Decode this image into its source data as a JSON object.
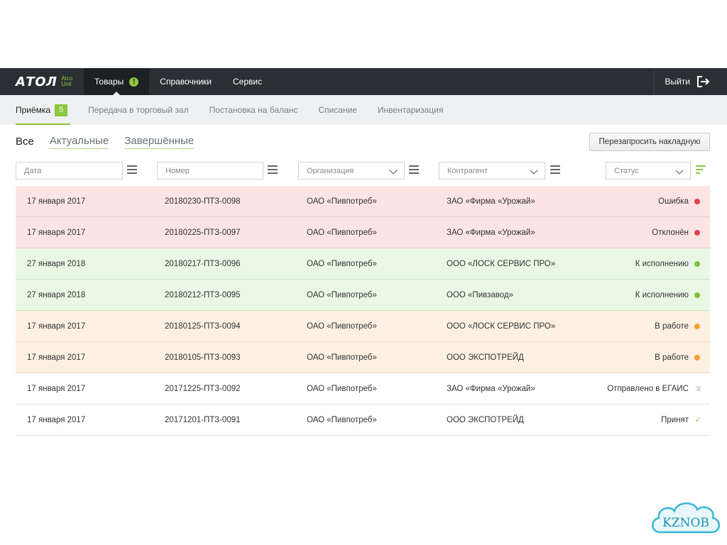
{
  "brand": {
    "name": "АТОЛ",
    "sub1": "Alco",
    "sub2": "Unit"
  },
  "nav": {
    "items": [
      {
        "label": "Товары",
        "alert": "!"
      },
      {
        "label": "Справочники"
      },
      {
        "label": "Сервис"
      }
    ],
    "logout_label": "Выйти"
  },
  "subnav": {
    "items": [
      {
        "label": "Приёмка",
        "badge": "5"
      },
      {
        "label": "Передача в торговый зал"
      },
      {
        "label": "Постановка на баланс"
      },
      {
        "label": "Списание"
      },
      {
        "label": "Инвентаризация"
      }
    ]
  },
  "tabs": [
    "Все",
    "Актуальные",
    "Завершённые"
  ],
  "reload_button": "Перезапросить накладную",
  "filters": {
    "date_placeholder": "Дата",
    "number_placeholder": "Номер",
    "org_placeholder": "Организация",
    "contractor_placeholder": "Контрагент",
    "status_placeholder": "Статус"
  },
  "rows": [
    {
      "date": "17 января 2017",
      "number": "20180230-ПТЗ-0098",
      "org": "ОАО «Пивпотреб»",
      "contractor": "ЗАО «Фирма «Урожай»",
      "status": "Ошибка",
      "tone": "red",
      "icon": "red-dot-icon"
    },
    {
      "date": "17 января 2017",
      "number": "20180225-ПТЗ-0097",
      "org": "ОАО «Пивпотреб»",
      "contractor": "ЗАО «Фирма «Урожай»",
      "status": "Отклонён",
      "tone": "red",
      "icon": "red-dot-icon"
    },
    {
      "date": "27 января 2018",
      "number": "20180217-ПТЗ-0096",
      "org": "ОАО «Пивпотреб»",
      "contractor": "ООО «ЛОСК СЕРВИС ПРО»",
      "status": "К исполнению",
      "tone": "green",
      "icon": "green-dot-icon"
    },
    {
      "date": "27 января 2018",
      "number": "20180212-ПТЗ-0095",
      "org": "ОАО «Пивпотреб»",
      "contractor": "ООО «Пивзавод»",
      "status": "К исполнению",
      "tone": "green",
      "icon": "green-dot-icon"
    },
    {
      "date": "17 января 2017",
      "number": "20180125-ПТЗ-0094",
      "org": "ОАО «Пивпотреб»",
      "contractor": "ООО «ЛОСК СЕРВИС ПРО»",
      "status": "В работе",
      "tone": "orange",
      "icon": "orange-dot-icon"
    },
    {
      "date": "17 января 2017",
      "number": "20180105-ПТЗ-0093",
      "org": "ОАО «Пивпотреб»",
      "contractor": "ООО ЭКСПОТРЕЙД",
      "status": "В работе",
      "tone": "orange",
      "icon": "orange-dot-icon"
    },
    {
      "date": "17 января 2017",
      "number": "20171225-ПТЗ-0092",
      "org": "ОАО «Пивпотреб»",
      "contractor": "ЗАО «Фирма «Урожай»",
      "status": "Отправлено в ЕГАИС",
      "tone": "white",
      "icon": "hourglass-icon"
    },
    {
      "date": "17 января 2017",
      "number": "20171201-ПТЗ-0091",
      "org": "ОАО «Пивпотреб»",
      "contractor": "ООО ЭКСПОТРЕЙД",
      "status": "Принят",
      "tone": "white",
      "icon": "checkmark-icon"
    }
  ],
  "colors": {
    "accent": "#8cc63f",
    "red": "#e0434b",
    "green": "#7cc142",
    "orange": "#f0a232",
    "topbar": "#2b2f33"
  },
  "watermark": "KZNOB"
}
